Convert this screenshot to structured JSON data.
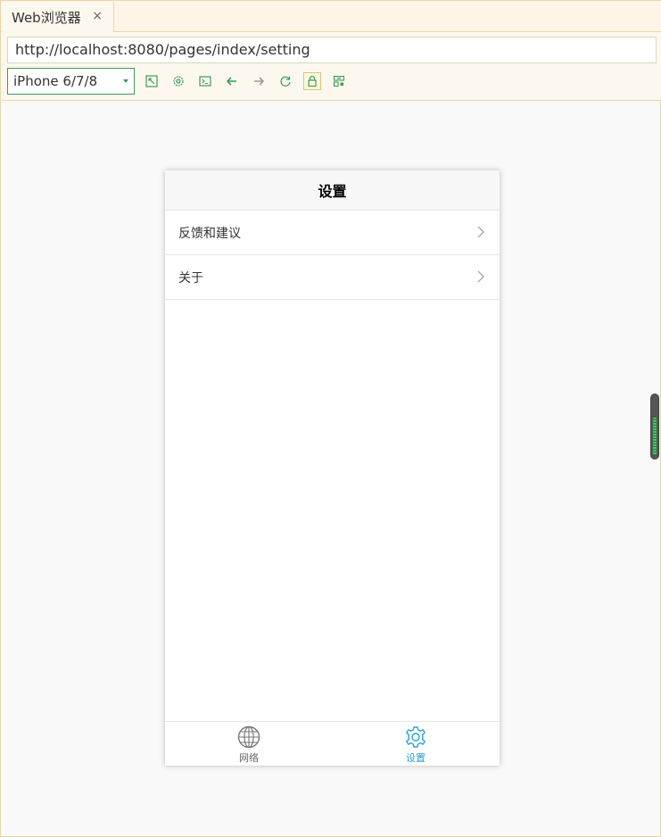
{
  "browser": {
    "tab_title": "Web浏览器",
    "tab_close": "×",
    "url": "http://localhost:8080/pages/index/setting",
    "device": "iPhone 6/7/8"
  },
  "toolbar": {
    "icons": [
      "resize-icon",
      "settings-icon",
      "console-icon",
      "back-icon",
      "forward-icon",
      "reload-icon",
      "lock-icon",
      "qrcode-icon"
    ]
  },
  "page": {
    "title": "设置",
    "items": [
      {
        "label": "反馈和建议"
      },
      {
        "label": "关于"
      }
    ]
  },
  "tabbar": {
    "items": [
      {
        "label": "网络",
        "icon": "globe-icon",
        "active": false
      },
      {
        "label": "设置",
        "icon": "gear-icon",
        "active": true
      }
    ],
    "active_color": "#2a9fd8",
    "inactive_color": "#666666"
  }
}
